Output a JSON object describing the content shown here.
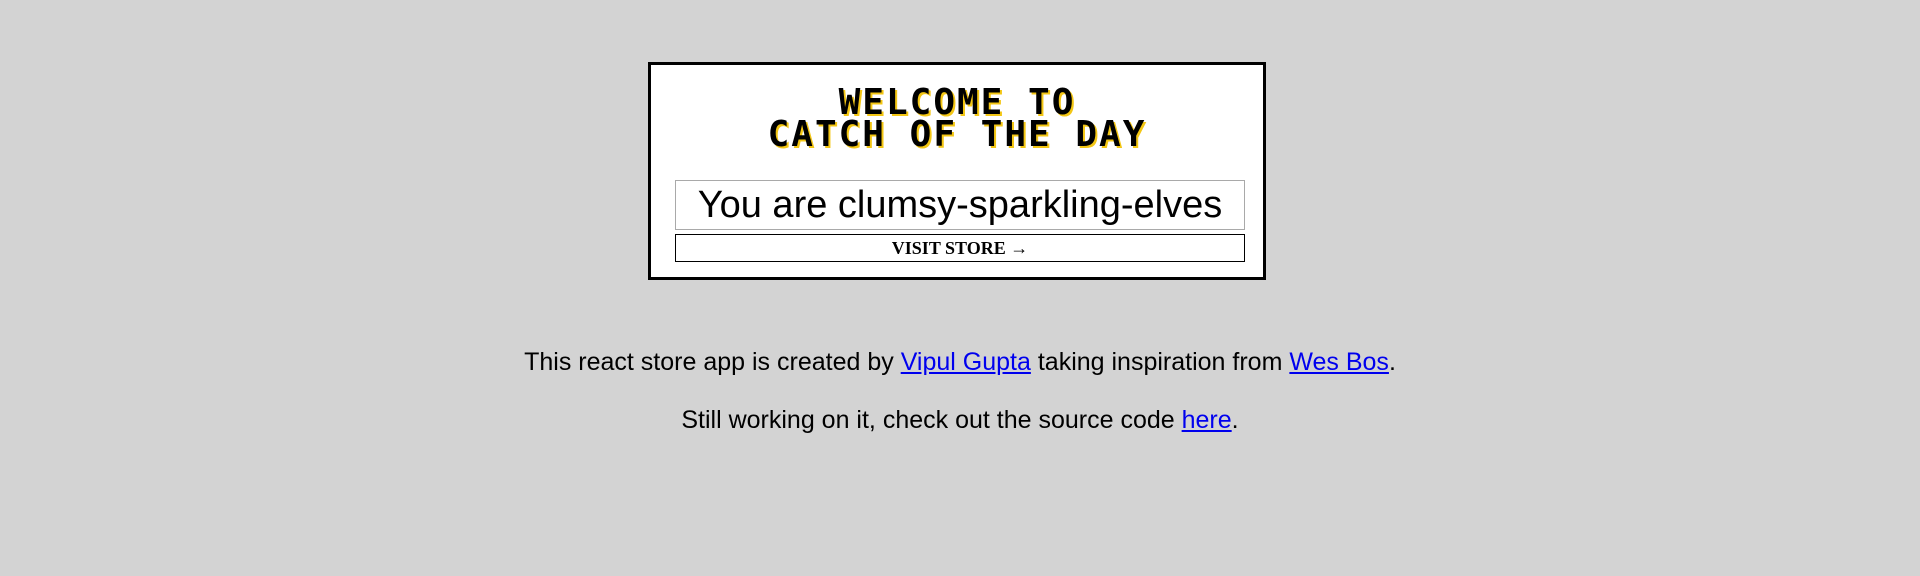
{
  "store_selector": {
    "title_line1": "WELCOME TO",
    "title_line2": "CATCH OF THE DAY",
    "store_name_value": "You are clumsy-sparkling-elves",
    "visit_button_label": "VISIT STORE →"
  },
  "credits": {
    "line1_prefix": "This react store app is created by",
    "author_link": "Vipul Gupta",
    "line1_middle": "taking inspiration from",
    "inspiration_link": "Wes Bos",
    "line1_suffix": ".",
    "line2_prefix": "Still working on it, check out the source code",
    "source_link": "here",
    "line2_suffix": "."
  },
  "colors": {
    "background": "#d3d3d3",
    "panel": "#ffffff",
    "link": "#0000ee",
    "title_shadow": "#f3c614"
  }
}
